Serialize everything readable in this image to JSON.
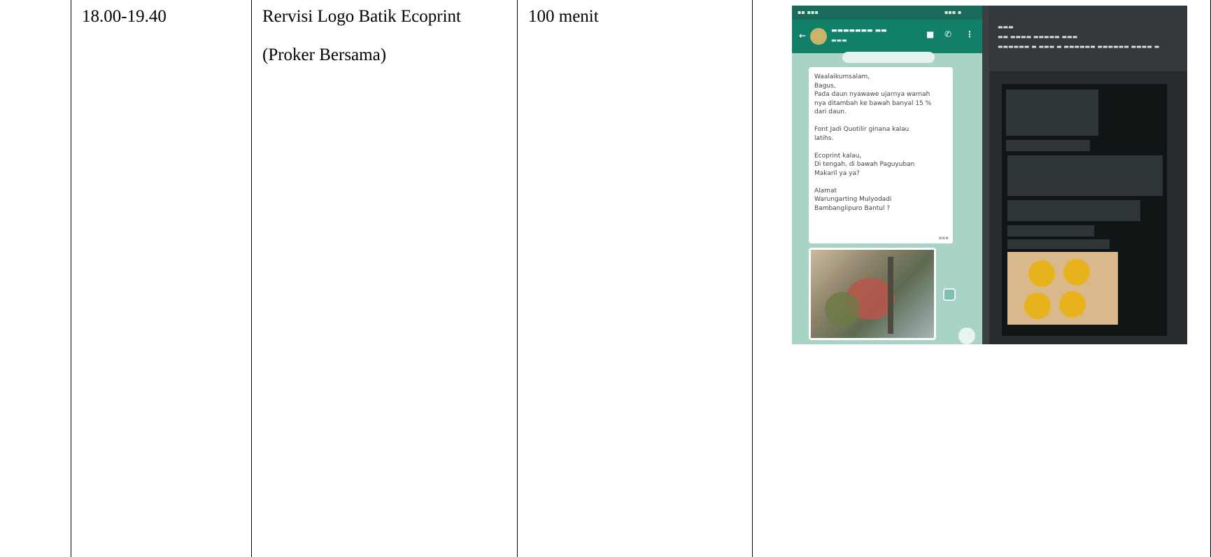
{
  "table": {
    "time": "18.00-19.40",
    "activity_line1": "Rervisi Logo Batik Ecoprint",
    "activity_line2": "(Proker Bersama)",
    "duration": "100 menit"
  },
  "evidence_screenshot": {
    "chat_message": "Waalaikumsalam,\nBagus,\nPada daun nyawawe ujarnya warnah\nnya ditambah ke bawah banyal 15 %\ndari daun.\n\nFont Jadi Quotilir ginana kalau\nlatihs.\n\nEcoprint kalau,\nDi tengah, di bawah Paguyuban\nMakaril ya ya?\n\nAlamat\nWarungarting Mulyodadi\nBambanglipuro Bantul ?"
  }
}
